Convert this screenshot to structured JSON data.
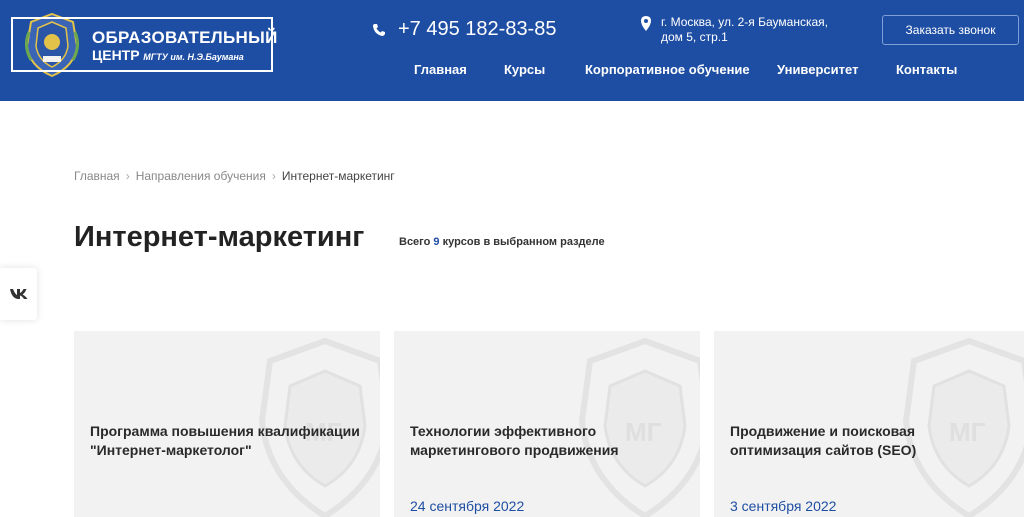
{
  "header": {
    "logo": {
      "line1": "ОБРАЗОВАТЕЛЬНЫЙ",
      "line2_main": "ЦЕНТР",
      "line2_sub": "МГТУ им. Н.Э.Баумана"
    },
    "phone": "+7 495 182-83-85",
    "address_line1": "г. Москва, ул. 2-я Бауманская,",
    "address_line2": "дом 5, стр.1",
    "callback_label": "Заказать звонок",
    "nav": [
      "Главная",
      "Курсы",
      "Корпоративное обучение",
      "Университет",
      "Контакты"
    ]
  },
  "breadcrumb": {
    "home": "Главная",
    "section": "Направления обучения",
    "current": "Интернет-маркетинг"
  },
  "page": {
    "title": "Интернет-маркетинг",
    "count_prefix": "Всего",
    "count_value": "9",
    "count_suffix": "курсов в выбранном разделе"
  },
  "social": {
    "vk_icon": "vk-icon"
  },
  "cards": [
    {
      "title": "Программа повышения квалификации \"Интернет-маркетолог\"",
      "date": ""
    },
    {
      "title": "Технологии эффективного маркетингового продвижения",
      "date": "24 сентября 2022"
    },
    {
      "title": "Продвижение и поисковая оптимизация сайтов (SEO)",
      "date": "3 сентября 2022"
    }
  ],
  "colors": {
    "brand": "#1e4ea3",
    "card_bg": "#f2f2f2"
  }
}
